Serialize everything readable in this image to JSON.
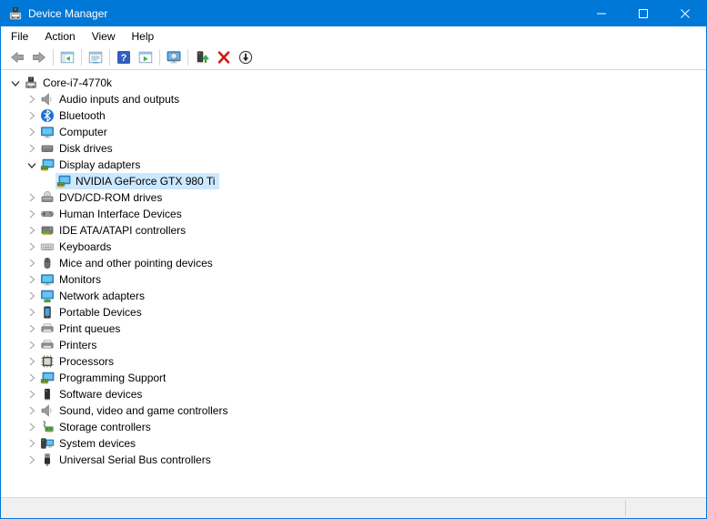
{
  "window": {
    "title": "Device Manager",
    "app_icon": "device-manager-icon",
    "controls": [
      {
        "name": "minimize-button",
        "icon": "minimize-icon"
      },
      {
        "name": "maximize-button",
        "icon": "maximize-icon"
      },
      {
        "name": "close-button",
        "icon": "close-icon"
      }
    ]
  },
  "menu": {
    "items": [
      {
        "label": "File"
      },
      {
        "label": "Action"
      },
      {
        "label": "View"
      },
      {
        "label": "Help"
      }
    ]
  },
  "toolbar": {
    "buttons": [
      {
        "name": "back-button",
        "icon": "back-arrow-icon"
      },
      {
        "name": "forward-button",
        "icon": "forward-arrow-icon"
      },
      {
        "sep": true
      },
      {
        "name": "show-console-tree-button",
        "icon": "console-tree-icon"
      },
      {
        "sep": true
      },
      {
        "name": "properties-button",
        "icon": "properties-icon"
      },
      {
        "sep": true
      },
      {
        "name": "help-button",
        "icon": "help-icon"
      },
      {
        "name": "show-action-pane-button",
        "icon": "action-pane-icon"
      },
      {
        "sep": true
      },
      {
        "name": "scan-hardware-changes-button",
        "icon": "scan-hardware-icon"
      },
      {
        "sep": true
      },
      {
        "name": "update-driver-button",
        "icon": "update-driver-icon"
      },
      {
        "name": "uninstall-device-button",
        "icon": "uninstall-icon"
      },
      {
        "name": "disable-device-button",
        "icon": "disable-icon"
      }
    ]
  },
  "tree": {
    "items": [
      {
        "label": "Core-i7-4770k",
        "icon": "computer-root-icon",
        "level": 0,
        "state": "expanded",
        "selected": false
      },
      {
        "label": "Audio inputs and outputs",
        "icon": "speaker-icon",
        "level": 1,
        "state": "collapsed",
        "selected": false
      },
      {
        "label": "Bluetooth",
        "icon": "bluetooth-icon",
        "level": 1,
        "state": "collapsed",
        "selected": false
      },
      {
        "label": "Computer",
        "icon": "monitor-icon",
        "level": 1,
        "state": "collapsed",
        "selected": false
      },
      {
        "label": "Disk drives",
        "icon": "disk-drive-icon",
        "level": 1,
        "state": "collapsed",
        "selected": false
      },
      {
        "label": "Display adapters",
        "icon": "display-adapter-icon",
        "level": 1,
        "state": "expanded",
        "selected": false
      },
      {
        "label": "NVIDIA GeForce GTX 980 Ti",
        "icon": "display-adapter-icon",
        "level": 2,
        "state": "leaf",
        "selected": true
      },
      {
        "label": "DVD/CD-ROM drives",
        "icon": "dvd-drive-icon",
        "level": 1,
        "state": "collapsed",
        "selected": false
      },
      {
        "label": "Human Interface Devices",
        "icon": "gamepad-icon",
        "level": 1,
        "state": "collapsed",
        "selected": false
      },
      {
        "label": "IDE ATA/ATAPI controllers",
        "icon": "ide-controller-icon",
        "level": 1,
        "state": "collapsed",
        "selected": false
      },
      {
        "label": "Keyboards",
        "icon": "keyboard-icon",
        "level": 1,
        "state": "collapsed",
        "selected": false
      },
      {
        "label": "Mice and other pointing devices",
        "icon": "mouse-icon",
        "level": 1,
        "state": "collapsed",
        "selected": false
      },
      {
        "label": "Monitors",
        "icon": "monitor-icon",
        "level": 1,
        "state": "collapsed",
        "selected": false
      },
      {
        "label": "Network adapters",
        "icon": "network-adapter-icon",
        "level": 1,
        "state": "collapsed",
        "selected": false
      },
      {
        "label": "Portable Devices",
        "icon": "phone-icon",
        "level": 1,
        "state": "collapsed",
        "selected": false
      },
      {
        "label": "Print queues",
        "icon": "printer-icon",
        "level": 1,
        "state": "collapsed",
        "selected": false
      },
      {
        "label": "Printers",
        "icon": "printer-icon",
        "level": 1,
        "state": "collapsed",
        "selected": false
      },
      {
        "label": "Processors",
        "icon": "processor-icon",
        "level": 1,
        "state": "collapsed",
        "selected": false
      },
      {
        "label": "Programming Support",
        "icon": "display-adapter-icon",
        "level": 1,
        "state": "collapsed",
        "selected": false
      },
      {
        "label": "Software devices",
        "icon": "software-device-icon",
        "level": 1,
        "state": "collapsed",
        "selected": false
      },
      {
        "label": "Sound, video and game controllers",
        "icon": "speaker-icon",
        "level": 1,
        "state": "collapsed",
        "selected": false
      },
      {
        "label": "Storage controllers",
        "icon": "storage-controller-icon",
        "level": 1,
        "state": "collapsed",
        "selected": false
      },
      {
        "label": "System devices",
        "icon": "system-device-icon",
        "level": 1,
        "state": "collapsed",
        "selected": false
      },
      {
        "label": "Universal Serial Bus controllers",
        "icon": "usb-icon",
        "level": 1,
        "state": "collapsed",
        "selected": false
      }
    ]
  },
  "statusbar": {
    "left": "",
    "right": ""
  },
  "colors": {
    "titlebar": "#0078d7",
    "selection": "#cce8ff",
    "window_border": "#0078d7",
    "statusbar_bg": "#f0f0f0",
    "toolbar_border": "#d7d7d7"
  }
}
